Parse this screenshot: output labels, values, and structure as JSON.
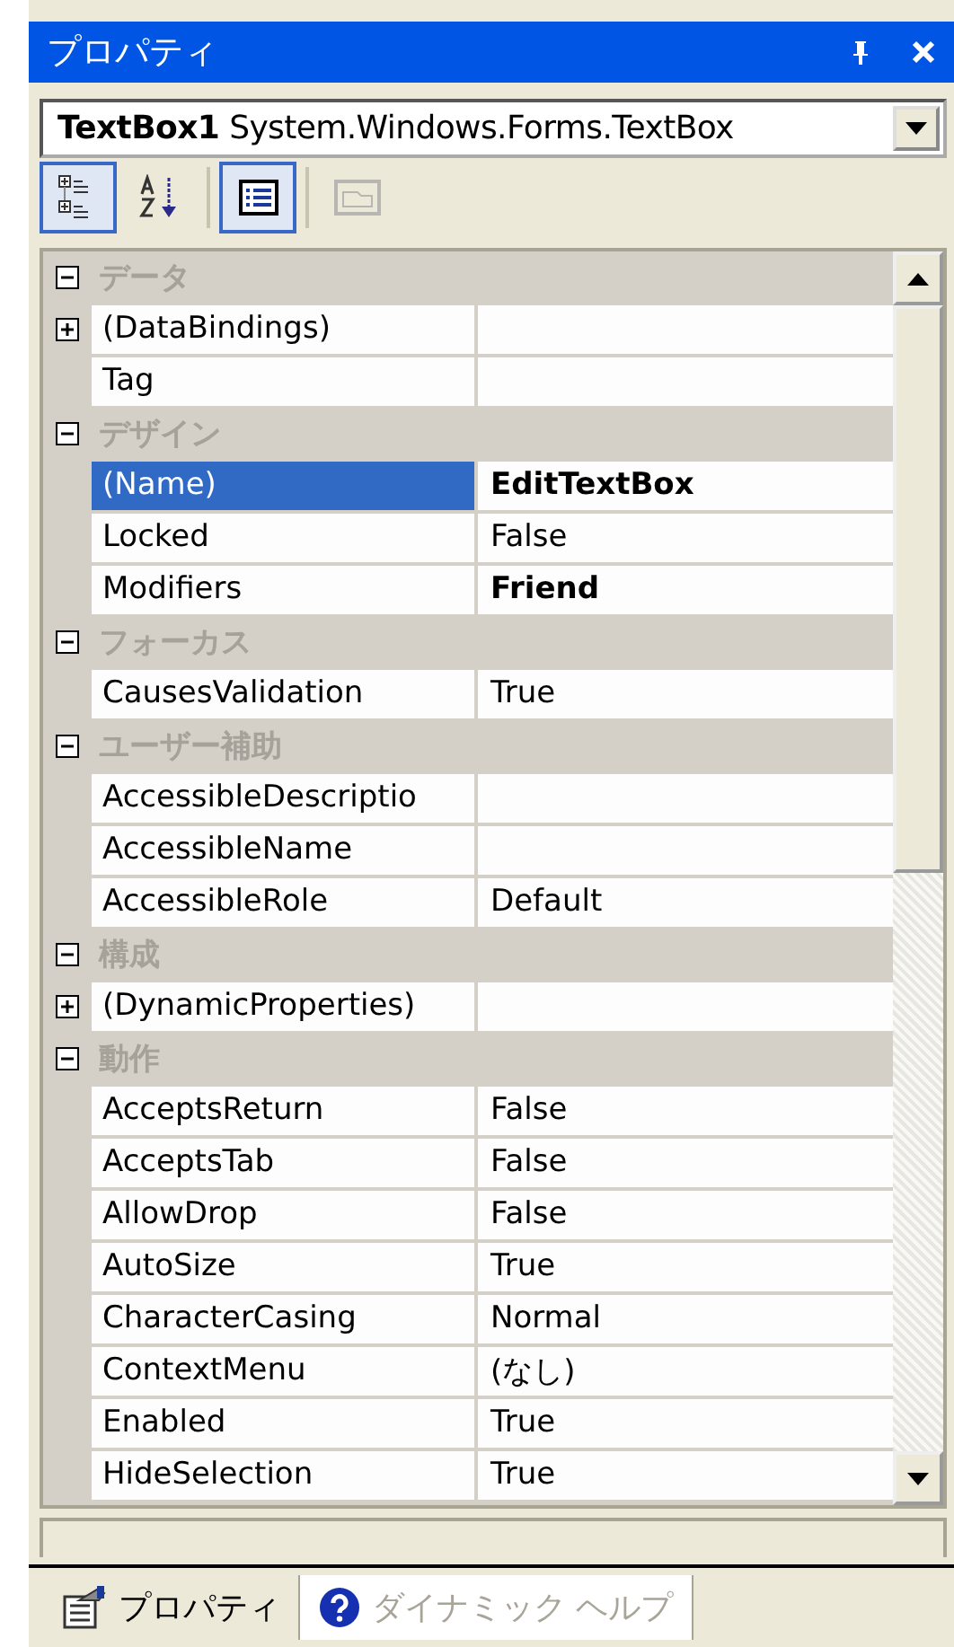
{
  "window": {
    "title": "プロパティ"
  },
  "object_selector": {
    "name": "TextBox1",
    "type": "System.Windows.Forms.TextBox"
  },
  "toolbar": [
    {
      "kind": "categorized",
      "selected": true,
      "disabled": false
    },
    {
      "kind": "alphabetical",
      "selected": false,
      "disabled": false
    },
    {
      "kind": "properties",
      "selected": true,
      "disabled": false
    },
    {
      "kind": "events",
      "selected": false,
      "disabled": true
    }
  ],
  "categories": [
    {
      "label": "データ",
      "expanded": true,
      "properties": [
        {
          "name": "(DataBindings)",
          "selected": false,
          "expandable": true
        },
        {
          "name": "Tag",
          "selected": false,
          "expandable": false
        }
      ]
    },
    {
      "label": "デザイン",
      "expanded": true,
      "properties": [
        {
          "name": "(Name)",
          "value": "EditTextBox",
          "bold": true,
          "selected": true,
          "expandable": false
        },
        {
          "name": "Locked",
          "value": "False",
          "bold": false,
          "selected": false,
          "expandable": false
        },
        {
          "name": "Modifiers",
          "value": "Friend",
          "bold": true,
          "selected": false,
          "expandable": false
        }
      ]
    },
    {
      "label": "フォーカス",
      "expanded": true,
      "properties": [
        {
          "name": "CausesValidation",
          "value": "True",
          "bold": false,
          "selected": false,
          "expandable": false
        }
      ]
    },
    {
      "label": "ユーザー補助",
      "expanded": true,
      "properties": [
        {
          "name": "AccessibleDescriptio",
          "selected": false,
          "expandable": false
        },
        {
          "name": "AccessibleName",
          "selected": false,
          "expandable": false
        },
        {
          "name": "AccessibleRole",
          "value": "Default",
          "bold": false,
          "selected": false,
          "expandable": false
        }
      ]
    },
    {
      "label": "構成",
      "expanded": true,
      "properties": [
        {
          "name": "(DynamicProperties)",
          "selected": false,
          "expandable": true
        }
      ]
    },
    {
      "label": "動作",
      "expanded": true,
      "properties": [
        {
          "name": "AcceptsReturn",
          "value": "False",
          "bold": false,
          "selected": false,
          "expandable": false
        },
        {
          "name": "AcceptsTab",
          "value": "False",
          "bold": false,
          "selected": false,
          "expandable": false
        },
        {
          "name": "AllowDrop",
          "value": "False",
          "bold": false,
          "selected": false,
          "expandable": false
        },
        {
          "name": "AutoSize",
          "value": "True",
          "bold": false,
          "selected": false,
          "expandable": false
        },
        {
          "name": "CharacterCasing",
          "value": "Normal",
          "bold": false,
          "selected": false,
          "expandable": false
        },
        {
          "name": "ContextMenu",
          "value": "(なし)",
          "bold": false,
          "selected": false,
          "expandable": false
        },
        {
          "name": "Enabled",
          "value": "True",
          "bold": false,
          "selected": false,
          "expandable": false
        },
        {
          "name": "HideSelection",
          "value": "True",
          "bold": false,
          "selected": false,
          "expandable": false
        }
      ]
    }
  ],
  "tabs": [
    {
      "label": "プロパティ",
      "kind": "properties",
      "selected": true
    },
    {
      "label": "ダイナミック ヘルプ",
      "kind": "help",
      "selected": false
    }
  ]
}
